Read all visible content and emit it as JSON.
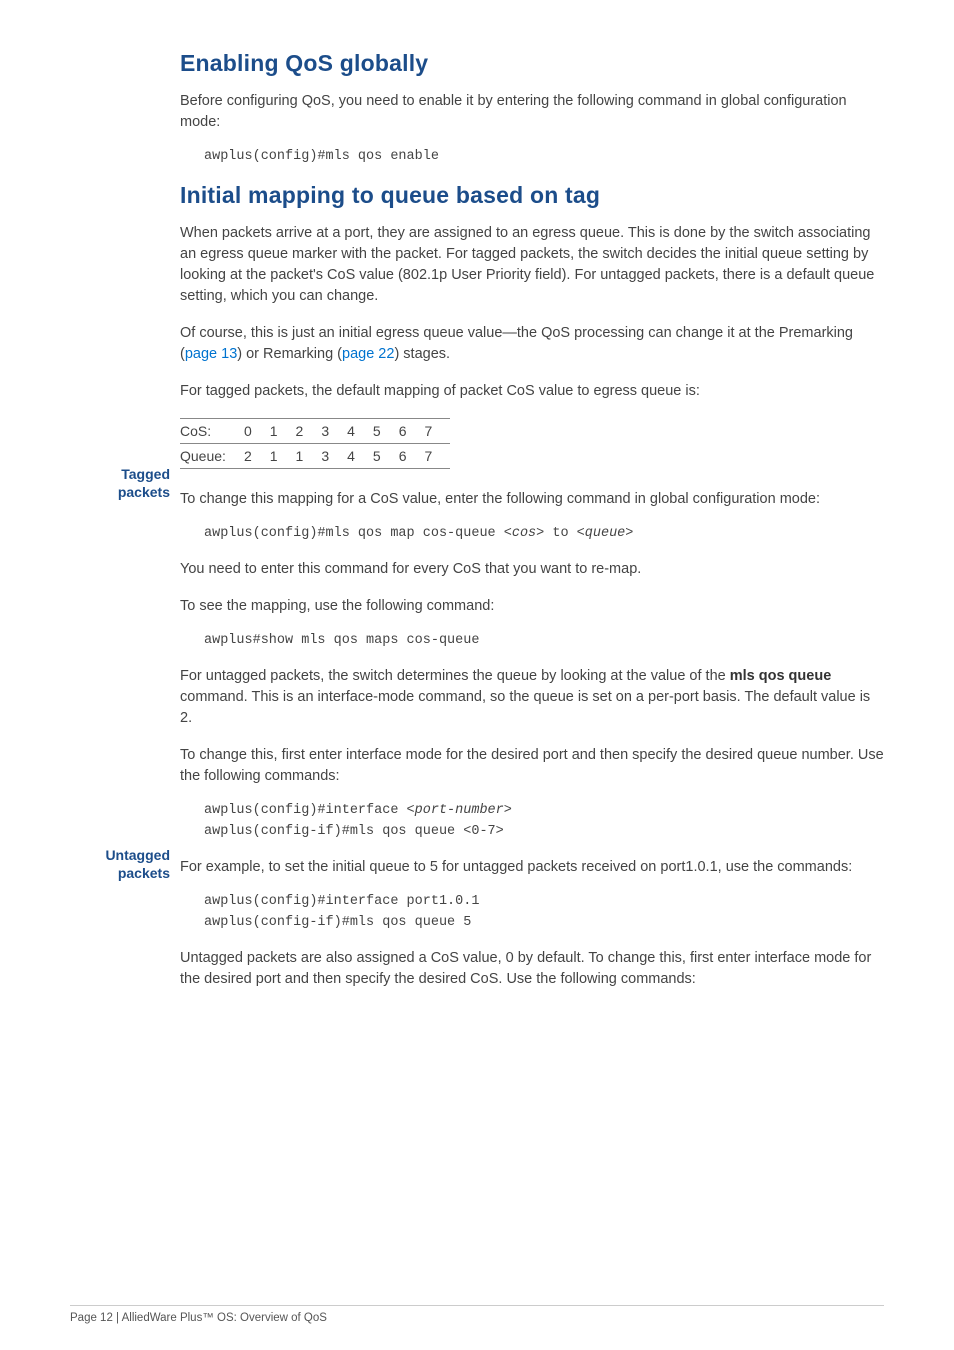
{
  "sec1": {
    "title": "Enabling QoS globally",
    "p1": "Before configuring QoS, you need to enable it by entering the following command in global configuration mode:",
    "code1": "awplus(config)#mls qos enable"
  },
  "sec2": {
    "title": "Initial mapping to queue based on tag",
    "p1": "When packets arrive at a port, they are assigned to an egress queue. This is done by the switch associating an egress queue marker with the packet. For tagged packets, the switch decides the initial queue setting by looking at the packet's CoS value (802.1p User Priority field). For untagged packets, there is a default queue setting, which you can change.",
    "p2a": "Of course, this is just an initial egress queue value—the QoS processing can change it at the Premarking (",
    "link1": "page 13",
    "p2b": ") or Remarking (",
    "link2": "page 22",
    "p2c": ") stages."
  },
  "tagged": {
    "label": "Tagged packets",
    "intro": "For tagged packets, the default mapping of packet CoS value to egress queue is:",
    "row1_label": "CoS:",
    "row2_label": "Queue:",
    "cos": [
      "0",
      "1",
      "2",
      "3",
      "4",
      "5",
      "6",
      "7"
    ],
    "queue": [
      "2",
      "1",
      "1",
      "3",
      "4",
      "5",
      "6",
      "7"
    ],
    "p1": "To change this mapping for a CoS value, enter the following command in global configuration mode:",
    "code1a": "awplus(config)#mls qos map cos-queue <",
    "code1_i1": "cos",
    "code1b": "> to <",
    "code1_i2": "queue",
    "code1c": ">",
    "p2": "You need to enter this command for every CoS that you want to re-map.",
    "p3": "To see the mapping, use the following command:",
    "code2": "awplus#show mls qos maps cos-queue"
  },
  "untagged": {
    "label": "Untagged packets",
    "p1a": "For untagged packets, the switch determines the queue by looking at the value of the ",
    "p1_bold1": "mls qos queue",
    "p1b": " command. This is an interface-mode command, so the queue is set on a per-port basis. The default value is 2.",
    "p2": "To change this, first enter interface mode for the desired port and then specify the desired queue number. Use the following commands:",
    "code1a": "awplus(config)#interface <",
    "code1_i1": "port-number",
    "code1b": ">",
    "code2": "awplus(config-if)#mls qos queue <0-7>",
    "p3": "For example, to set the initial queue to 5 for untagged packets received on port1.0.1, use the commands:",
    "code3": "awplus(config)#interface port1.0.1",
    "code4": "awplus(config-if)#mls qos queue 5",
    "p4": "Untagged packets are also assigned a CoS value, 0 by default. To change this, first enter interface mode for the desired port and then specify the desired CoS. Use the following commands:"
  },
  "footer": "Page 12 | AlliedWare Plus™ OS: Overview of QoS",
  "chart_data": {
    "type": "table",
    "title": "Default mapping of packet CoS value to egress queue",
    "columns": [
      "CoS",
      "Queue"
    ],
    "rows": [
      [
        0,
        2
      ],
      [
        1,
        1
      ],
      [
        2,
        1
      ],
      [
        3,
        3
      ],
      [
        4,
        4
      ],
      [
        5,
        5
      ],
      [
        6,
        6
      ],
      [
        7,
        7
      ]
    ]
  }
}
